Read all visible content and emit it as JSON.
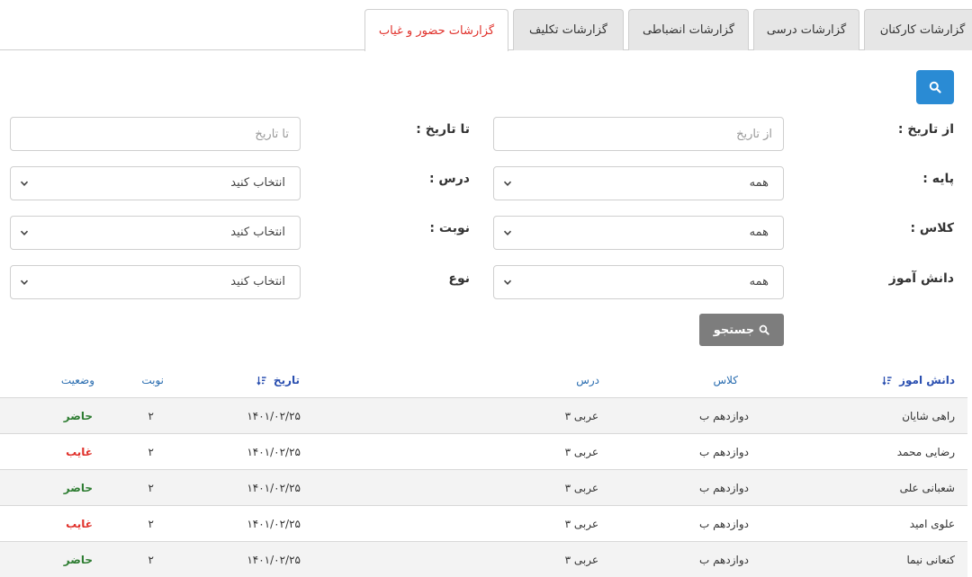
{
  "tabs": [
    {
      "label": "گزارشات کارکنان",
      "active": false
    },
    {
      "label": "گزارشات درسی",
      "active": false
    },
    {
      "label": "گزارشات انضباطی",
      "active": false
    },
    {
      "label": "گزارشات تکلیف",
      "active": false
    },
    {
      "label": "گزارشات حضور و غیاب",
      "active": true
    }
  ],
  "form": {
    "from_date_label": "از تاریخ :",
    "from_date_placeholder": "از تاریخ",
    "to_date_label": "تا تاریخ :",
    "to_date_placeholder": "تا تاریخ",
    "grade_label": "پایه :",
    "grade_value": "همه",
    "lesson_label": "درس :",
    "lesson_value": "انتخاب کنید",
    "class_label": "کلاس :",
    "class_value": "همه",
    "shift_label": "نوبت :",
    "shift_value": "انتخاب کنید",
    "student_label": "دانش آموز",
    "student_value": "همه",
    "type_label": "نوع",
    "type_value": "انتخاب کنید",
    "search_label": "جستجو"
  },
  "table": {
    "headers": {
      "student": "دانش اموز",
      "class": "کلاس",
      "lesson": "درس",
      "date": "تاریخ",
      "shift": "نوبت",
      "status": "وضعیت"
    },
    "rows": [
      {
        "student": "راهی شایان",
        "class": "دوازدهم ب",
        "lesson": "عربی ۳",
        "date": "۱۴۰۱/۰۲/۲۵",
        "shift": "۲",
        "status": "حاضر"
      },
      {
        "student": "رضایی محمد",
        "class": "دوازدهم ب",
        "lesson": "عربی ۳",
        "date": "۱۴۰۱/۰۲/۲۵",
        "shift": "۲",
        "status": "غایب"
      },
      {
        "student": "شعبانی علی",
        "class": "دوازدهم ب",
        "lesson": "عربی ۳",
        "date": "۱۴۰۱/۰۲/۲۵",
        "shift": "۲",
        "status": "حاضر"
      },
      {
        "student": "علوی امید",
        "class": "دوازدهم ب",
        "lesson": "عربی ۳",
        "date": "۱۴۰۱/۰۲/۲۵",
        "shift": "۲",
        "status": "غایب"
      },
      {
        "student": "کنعانی نیما",
        "class": "دوازدهم ب",
        "lesson": "عربی ۳",
        "date": "۱۴۰۱/۰۲/۲۵",
        "shift": "۲",
        "status": "حاضر"
      }
    ]
  },
  "colors": {
    "accent": "#2a8bd4",
    "active_tab_text": "#e0302a",
    "present": "#2e7d32",
    "absent": "#e0302a",
    "search_button": "#7d7d7d",
    "header_text": "#2a6db0"
  }
}
